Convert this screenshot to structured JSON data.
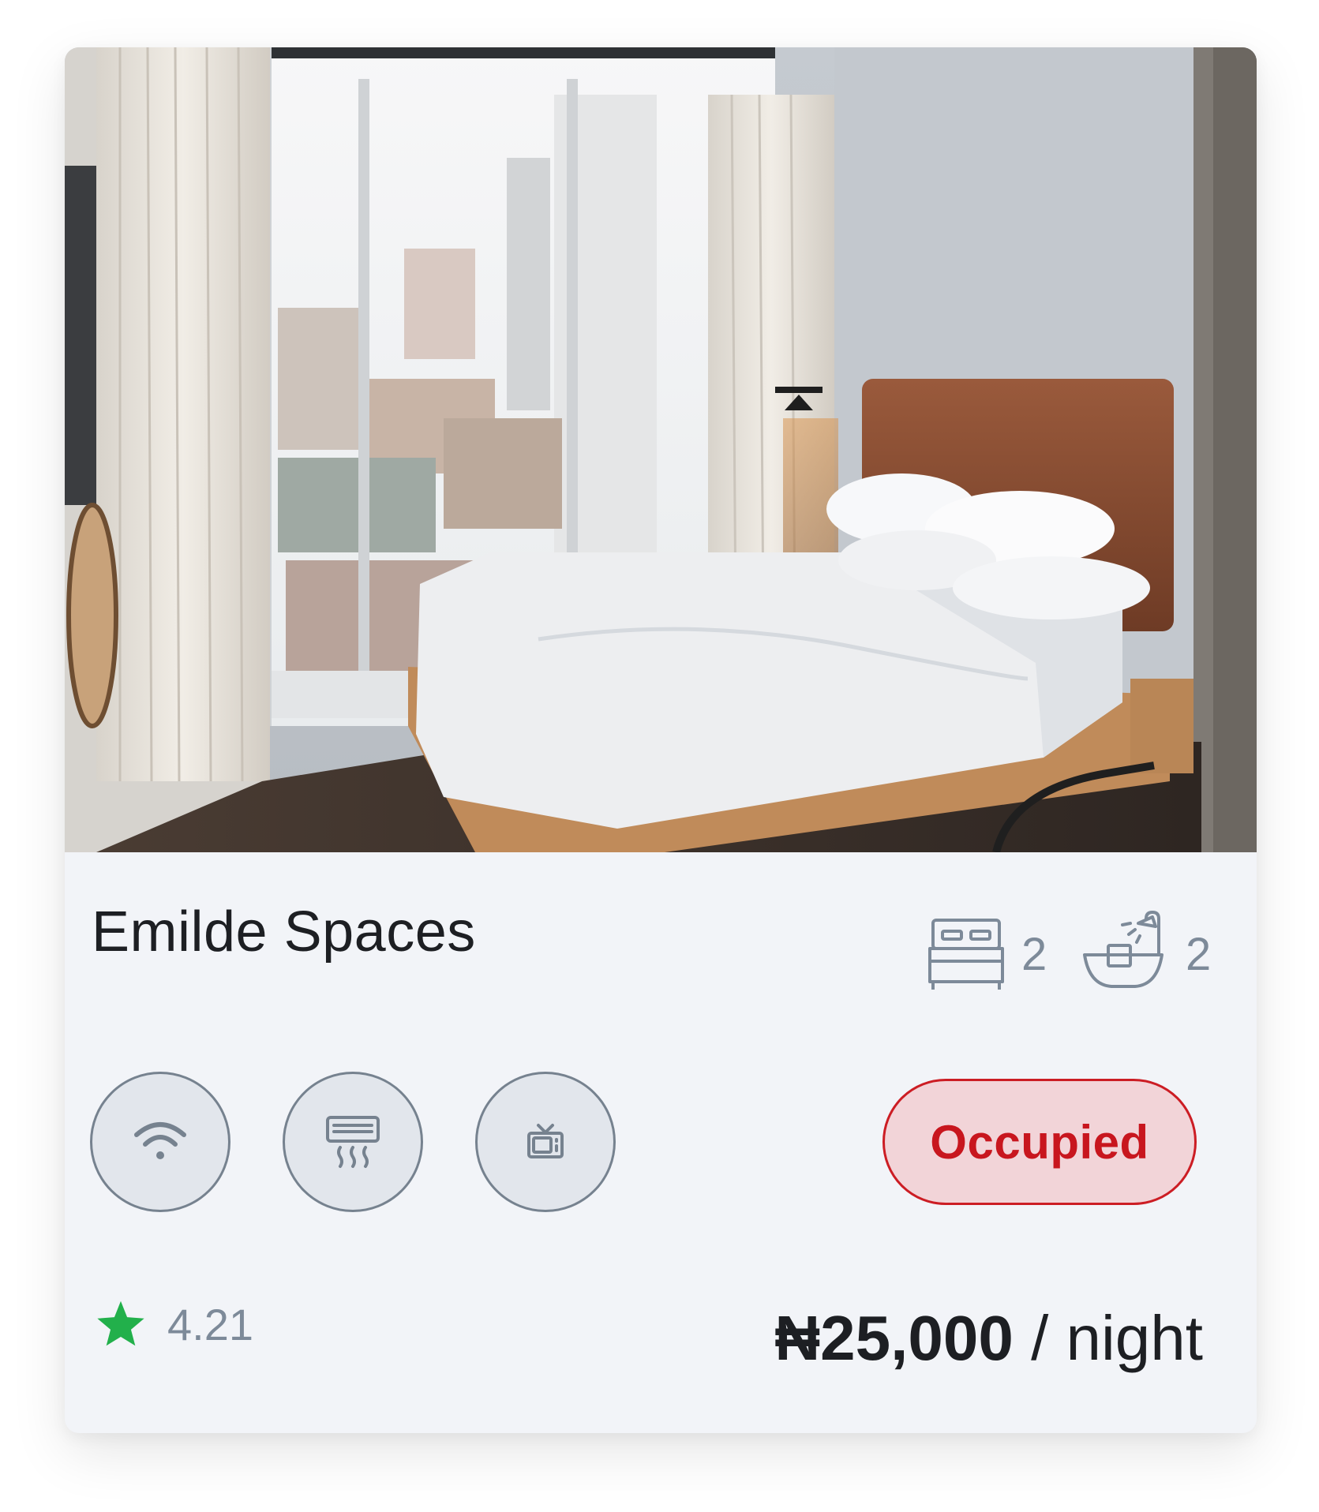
{
  "listing": {
    "name": "Emilde Spaces",
    "beds": "2",
    "baths": "2",
    "status": "Occupied",
    "rating": "4.21",
    "price_amount": "₦25,000",
    "price_unit": " / night",
    "amenities": [
      {
        "icon": "wifi-icon"
      },
      {
        "icon": "air-conditioner-icon"
      },
      {
        "icon": "tv-icon"
      }
    ],
    "photo": "hotel bedroom photo"
  },
  "colors": {
    "card_bg": "#f2f4f8",
    "status_text": "#c8161e",
    "status_bg": "#f2d4d8",
    "star": "#22b04b",
    "muted": "#7d8a99"
  }
}
